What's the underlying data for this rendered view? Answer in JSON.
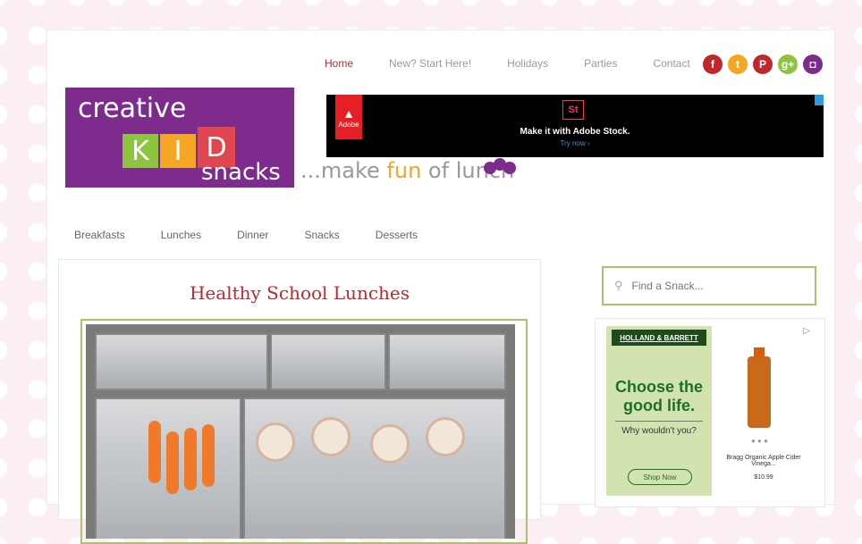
{
  "top_nav": [
    "Home",
    "New? Start Here!",
    "Holidays",
    "Parties",
    "Contact"
  ],
  "social": [
    {
      "icon": "facebook-icon",
      "glyph": "f",
      "color": "#c1272d"
    },
    {
      "icon": "twitter-icon",
      "glyph": "t",
      "color": "#f5a623"
    },
    {
      "icon": "pinterest-icon",
      "glyph": "P",
      "color": "#c1272d"
    },
    {
      "icon": "googleplus-icon",
      "glyph": "g+",
      "color": "#8ec540"
    },
    {
      "icon": "instagram-icon",
      "glyph": "◘",
      "color": "#7d2c8d"
    }
  ],
  "logo": {
    "creative": "creative",
    "k": "K",
    "i": "I",
    "d": "D",
    "snacks": "snacks"
  },
  "tagline": {
    "pre": "...make ",
    "fun": "fun",
    "post": " of lunch"
  },
  "adobe_ad": {
    "brand": "Adobe",
    "product_badge": "St",
    "headline": "Make it with Adobe Stock.",
    "cta": "Try now ›"
  },
  "cat_nav": [
    "Breakfasts",
    "Lunches",
    "Dinner",
    "Snacks",
    "Desserts"
  ],
  "post": {
    "title": "Healthy School Lunches"
  },
  "search": {
    "placeholder": "Find a Snack..."
  },
  "sidebar_ad": {
    "brand": "HOLLAND & BARRETT",
    "headline_1": "Choose the",
    "headline_2": "good life.",
    "subhead": "Why wouldn't you?",
    "button": "Shop Now",
    "product": "Bragg Organic Apple Cider Vinega...",
    "price": "$10.99",
    "dots": "● ● ●",
    "adchoice": "▷"
  }
}
